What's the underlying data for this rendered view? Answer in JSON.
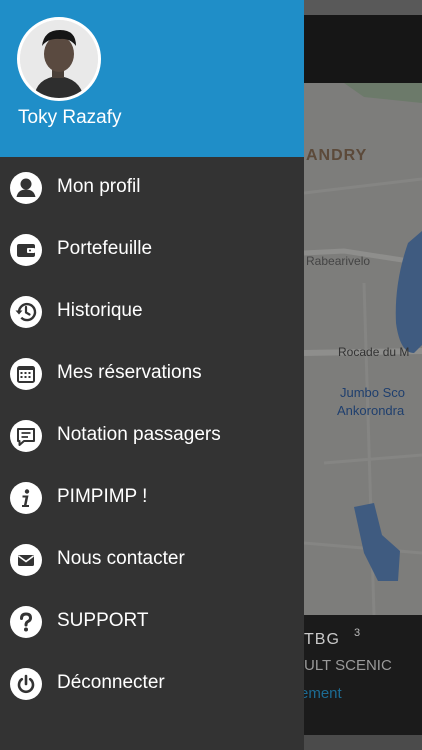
{
  "user": {
    "name": "Toky Razafy"
  },
  "menu": {
    "items": [
      {
        "label": "Mon profil",
        "icon": "person-icon"
      },
      {
        "label": "Portefeuille",
        "icon": "wallet-icon"
      },
      {
        "label": "Historique",
        "icon": "history-icon"
      },
      {
        "label": "Mes réservations",
        "icon": "calendar-icon"
      },
      {
        "label": "Notation passagers",
        "icon": "chat-icon"
      },
      {
        "label": "PIMPIMP !",
        "icon": "info-icon"
      },
      {
        "label": "Nous contacter",
        "icon": "mail-icon"
      },
      {
        "label": "SUPPORT",
        "icon": "question-icon"
      },
      {
        "label": "Déconnecter",
        "icon": "power-icon"
      }
    ]
  },
  "background": {
    "map": {
      "area_label": "ANDRY",
      "street_1": "Rabearivelo",
      "street_2": "Rocade du M",
      "poi_line_1": "Jumbo Sco",
      "poi_line_2": "Ankorondra"
    },
    "card": {
      "plate": "TBG",
      "model": "ULT SCENIC",
      "link": "ement",
      "number": "3"
    }
  },
  "colors": {
    "drawer_header": "#1f8ec8",
    "drawer_background": "#333333",
    "icon_circle": "#ffffff",
    "menu_text": "#ffffff"
  }
}
